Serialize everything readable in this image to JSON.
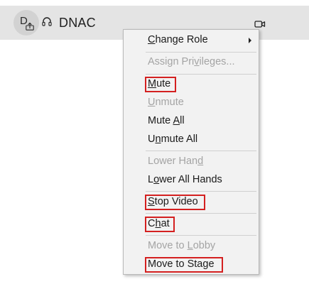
{
  "participant": {
    "avatar_initial": "D",
    "name": "DNAC"
  },
  "icons": {
    "share": "share-upload-icon",
    "headset": "headset-icon",
    "video": "video-camera-icon",
    "submenu": "chevron-right-icon"
  },
  "colors": {
    "participant_bar": "#e4e4e4",
    "menu_bg": "#f2f2f2",
    "highlight": "#d42020",
    "disabled_text": "#a4a4a4"
  },
  "menu": {
    "items": [
      {
        "pre": "",
        "u": "C",
        "post": "hange Role",
        "disabled": false,
        "has_submenu": true,
        "highlighted": false
      },
      {
        "pre": "Assign Pri",
        "u": "v",
        "post": "ileges...",
        "disabled": true,
        "has_submenu": false,
        "highlighted": false
      },
      {
        "pre": "",
        "u": "M",
        "post": "ute",
        "disabled": false,
        "has_submenu": false,
        "highlighted": true
      },
      {
        "pre": "",
        "u": "U",
        "post": "nmute",
        "disabled": true,
        "has_submenu": false,
        "highlighted": false
      },
      {
        "pre": "Mute ",
        "u": "A",
        "post": "ll",
        "disabled": false,
        "has_submenu": false,
        "highlighted": false
      },
      {
        "pre": "U",
        "u": "n",
        "post": "mute All",
        "disabled": false,
        "has_submenu": false,
        "highlighted": false
      },
      {
        "pre": "Lower Han",
        "u": "d",
        "post": "",
        "disabled": true,
        "has_submenu": false,
        "highlighted": false
      },
      {
        "pre": "L",
        "u": "o",
        "post": "wer All Hands",
        "disabled": false,
        "has_submenu": false,
        "highlighted": false
      },
      {
        "pre": "",
        "u": "S",
        "post": "top Video",
        "disabled": false,
        "has_submenu": false,
        "highlighted": true
      },
      {
        "pre": "C",
        "u": "h",
        "post": "at",
        "disabled": false,
        "has_submenu": false,
        "highlighted": true
      },
      {
        "pre": "Move to ",
        "u": "L",
        "post": "obby",
        "disabled": true,
        "has_submenu": false,
        "highlighted": false
      },
      {
        "pre": "Move to Sta",
        "u": "g",
        "post": "e",
        "disabled": false,
        "has_submenu": false,
        "highlighted": true
      }
    ]
  }
}
